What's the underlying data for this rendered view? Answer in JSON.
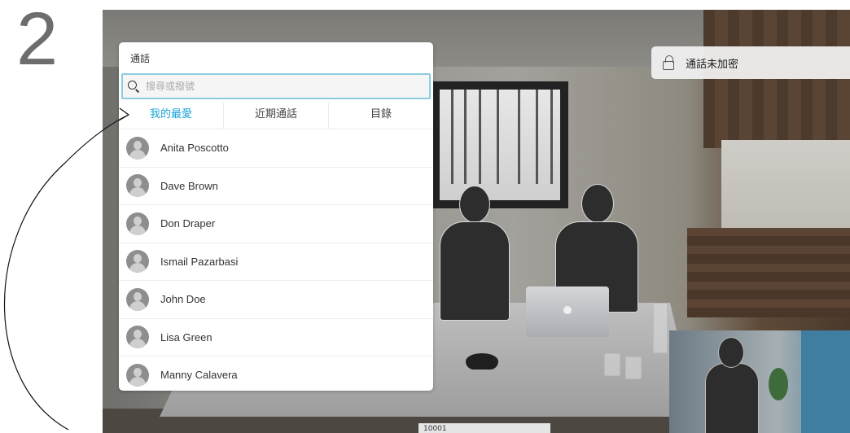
{
  "step": {
    "number": "2"
  },
  "call_panel": {
    "title": "通話",
    "search": {
      "placeholder": "搜尋或撥號",
      "value": ""
    },
    "tabs": [
      {
        "label": "我的最愛",
        "active": true
      },
      {
        "label": "近期通話",
        "active": false
      },
      {
        "label": "目錄",
        "active": false
      }
    ],
    "contacts": [
      {
        "name": "Anita Poscotto"
      },
      {
        "name": "Dave Brown"
      },
      {
        "name": "Don Draper"
      },
      {
        "name": "Ismail Pazarbasi"
      },
      {
        "name": "John Doe"
      },
      {
        "name": "Lisa Green"
      },
      {
        "name": "Manny Calavera"
      }
    ]
  },
  "encryption": {
    "label": "通話未加密",
    "icon": "unlocked-lock-icon"
  },
  "video": {
    "bottom_label": "10001"
  },
  "colors": {
    "accent": "#17a3d8",
    "search_border": "#8ccbe0"
  }
}
